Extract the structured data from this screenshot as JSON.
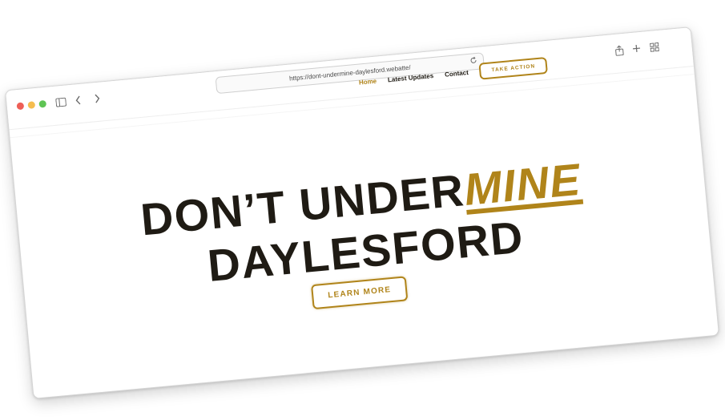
{
  "browser": {
    "url": "https://dont-undermine-daylesford.webatte/"
  },
  "site": {
    "nav": {
      "home": "Home",
      "latest_updates": "Latest Updates",
      "contact": "Contact",
      "take_action": "TAKE ACTION"
    },
    "hero": {
      "line1_prefix": "DON’T UNDER",
      "line1_accent": "MINE",
      "line2": "DAYLESFORD",
      "cta": "LEARN MORE"
    }
  },
  "colors": {
    "accent": "#b0841a",
    "text_dark": "#1f1b14",
    "background": "#ffffff"
  },
  "icons": {
    "sidebar": "sidebar-icon",
    "back": "chevron-left-icon",
    "forward": "chevron-right-icon",
    "reload": "reload-icon",
    "share": "share-icon",
    "new_tab": "plus-icon",
    "tab_overview": "grid-icon"
  }
}
